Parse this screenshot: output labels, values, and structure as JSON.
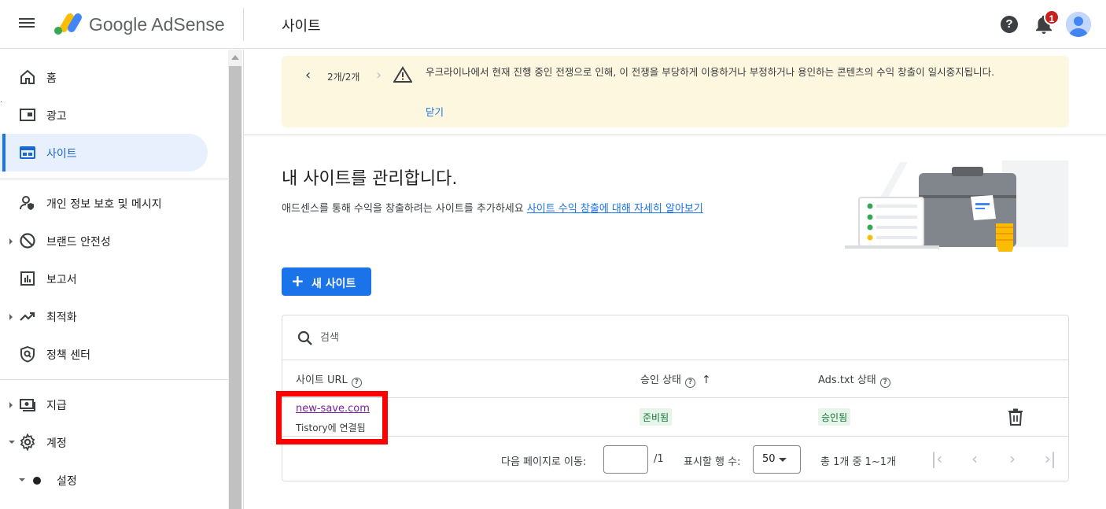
{
  "header": {
    "brand": "Google AdSense",
    "page_title": "사이트",
    "notification_count": "1",
    "help_label": "?"
  },
  "sidebar": {
    "items": [
      {
        "label": "홈",
        "icon": "home-icon"
      },
      {
        "label": "광고",
        "icon": "ads-icon"
      },
      {
        "label": "사이트",
        "icon": "sites-icon",
        "active": true
      },
      {
        "label": "개인 정보 보호 및 메시지",
        "icon": "privacy-icon"
      },
      {
        "label": "브랜드 안전성",
        "icon": "block-icon"
      },
      {
        "label": "보고서",
        "icon": "report-icon"
      },
      {
        "label": "최적화",
        "icon": "trending-icon"
      },
      {
        "label": "정책 센터",
        "icon": "policy-shield-icon"
      },
      {
        "label": "지급",
        "icon": "payments-icon"
      },
      {
        "label": "계정",
        "icon": "gear-icon"
      },
      {
        "label": "설정",
        "icon": "dot-icon"
      }
    ]
  },
  "alert": {
    "count": "2개/2개",
    "message": "우크라이나에서 현재 진행 중인 전쟁으로 인해, 이 전쟁을 부당하게 이용하거나 부정하거나 용인하는 콘텐츠의 수익 창출이 일시중지됩니다.",
    "close_label": "닫기"
  },
  "main": {
    "title": "내 사이트를 관리합니다.",
    "subtitle": "애드센스를 통해 수익을 창출하려는 사이트를 추가하세요",
    "learn_more": "사이트 수익 창출에 대해 자세히 알아보기",
    "new_site_button": "새 사이트"
  },
  "table": {
    "search_placeholder": "검색",
    "columns": {
      "site_url": "사이트 URL",
      "approval": "승인 상태",
      "ads_txt": "Ads.txt 상태"
    },
    "rows": [
      {
        "url": "new-save.com",
        "note": "Tistory에 연결됨",
        "approval": "준비됨",
        "ads_txt": "승인됨"
      }
    ],
    "pager": {
      "goto_label": "다음 페이지로 이동:",
      "page_total": "/1",
      "rows_label": "표시할 행 수:",
      "rows_value": "50",
      "summary": "총 1개 중 1~1개"
    }
  },
  "colors": {
    "accent": "#1a73e8",
    "alert_bg": "#fef7e0",
    "chip_bg": "#e6f4ea",
    "highlight": "#ff0000"
  }
}
